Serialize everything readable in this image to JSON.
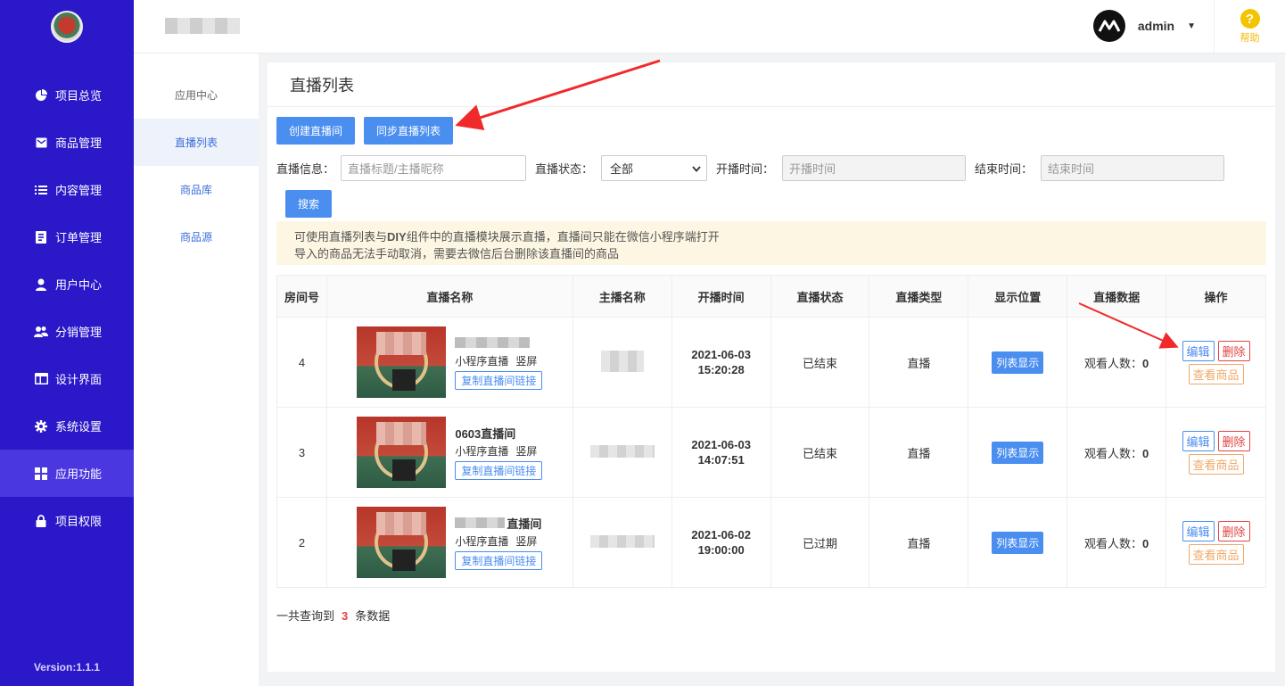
{
  "app": {
    "version": "Version:1.1.1"
  },
  "sidebar": {
    "items": [
      {
        "label": "项目总览",
        "icon": "pie-chart-icon"
      },
      {
        "label": "商品管理",
        "icon": "inbox-icon"
      },
      {
        "label": "内容管理",
        "icon": "list-icon"
      },
      {
        "label": "订单管理",
        "icon": "order-icon"
      },
      {
        "label": "用户中心",
        "icon": "user-icon"
      },
      {
        "label": "分销管理",
        "icon": "users-icon"
      },
      {
        "label": "设计界面",
        "icon": "layout-icon"
      },
      {
        "label": "系统设置",
        "icon": "gear-icon"
      },
      {
        "label": "应用功能",
        "icon": "grid-icon",
        "active": true
      },
      {
        "label": "项目权限",
        "icon": "lock-icon"
      }
    ]
  },
  "topbar": {
    "user": "admin",
    "help": "帮助"
  },
  "subnav": {
    "title": "应用中心",
    "items": [
      "直播列表",
      "商品库",
      "商品源"
    ]
  },
  "page": {
    "title": "直播列表",
    "create_label": "创建直播间",
    "sync_label": "同步直播列表",
    "search_label": "搜索"
  },
  "filters": {
    "info_label": "直播信息：",
    "info_placeholder": "直播标题/主播昵称",
    "status_label": "直播状态：",
    "status_value": "全部",
    "start_label": "开播时间：",
    "start_placeholder": "开播时间",
    "end_label": "结束时间：",
    "end_placeholder": "结束时间"
  },
  "notice": {
    "line1_pre": "可使用直播列表与",
    "line1_bold": "DIY",
    "line1_post": "组件中的直播模块展示直播，直播间只能在微信小程序端打开",
    "line2": "导入的商品无法手动取消，需要去微信后台删除该直播间的商品"
  },
  "table": {
    "headers": [
      "房间号",
      "直播名称",
      "主播名称",
      "开播时间",
      "直播状态",
      "直播类型",
      "显示位置",
      "直播数据",
      "操作"
    ],
    "rows": [
      {
        "id": "4",
        "name": "",
        "meta1": "小程序直播",
        "meta2": "竖屏",
        "copy": "复制直播间链接",
        "date": "2021-06-03",
        "time": "15:20:28",
        "status": "已结束",
        "type": "直播",
        "position": "列表显示",
        "viewers_label": "观看人数：",
        "viewers": "0"
      },
      {
        "id": "3",
        "name": "0603直播间",
        "meta1": "小程序直播",
        "meta2": "竖屏",
        "copy": "复制直播间链接",
        "date": "2021-06-03",
        "time": "14:07:51",
        "status": "已结束",
        "type": "直播",
        "position": "列表显示",
        "viewers_label": "观看人数：",
        "viewers": "0"
      },
      {
        "id": "2",
        "name": "直播间",
        "meta1": "小程序直播",
        "meta2": "竖屏",
        "copy": "复制直播间链接",
        "date": "2021-06-02",
        "time": "19:00:00",
        "status": "已过期",
        "type": "直播",
        "position": "列表显示",
        "viewers_label": "观看人数：",
        "viewers": "0"
      }
    ],
    "ops": {
      "edit": "编辑",
      "delete": "删除",
      "view": "查看商品"
    }
  },
  "footer": {
    "total_pre": "一共查询到",
    "total": "3",
    "total_post": "条数据"
  },
  "colors": {
    "sidebar": "#2b18c8",
    "primary": "#4a8ef0",
    "danger": "#e24343",
    "warning": "#f0a868",
    "arrow": "#f02a2a"
  }
}
